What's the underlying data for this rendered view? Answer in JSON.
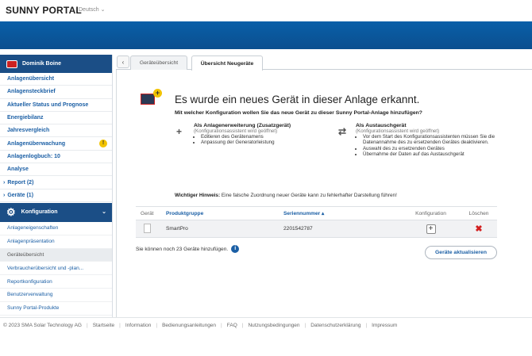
{
  "header": {
    "logo": "SUNNY PORTAL",
    "language": "Deutsch ⌄"
  },
  "sidebar": {
    "user": "Dominik Boine",
    "items": [
      {
        "label": "Anlagenübersicht"
      },
      {
        "label": "Anlagensteckbrief"
      },
      {
        "label": "Aktueller Status und Prognose"
      },
      {
        "label": "Energiebilanz"
      },
      {
        "label": "Jahresvergleich"
      },
      {
        "label": "Anlagenüberwachung",
        "warning": "!"
      },
      {
        "label": "Anlagenlogbuch: 10"
      },
      {
        "label": "Analyse"
      },
      {
        "label": "Report (2)",
        "chevron": "›"
      },
      {
        "label": "Geräte (1)",
        "chevron": "›"
      }
    ],
    "config_section": {
      "label": "Konfiguration",
      "chevron": "⌄"
    },
    "config_items": [
      {
        "label": "Anlageneigenschaften"
      },
      {
        "label": "Anlagenpräsentation"
      },
      {
        "label": "Geräteübersicht",
        "active": true
      },
      {
        "label": "Verbraucherübersicht und -plan..."
      },
      {
        "label": "Reportkonfiguration"
      },
      {
        "label": "Benutzerverwaltung"
      },
      {
        "label": "Sunny Portal-Produkte"
      }
    ]
  },
  "tabs": {
    "back": "‹",
    "tab1": "Geräteübersicht",
    "tab2": "Übersicht Neugeräte"
  },
  "main": {
    "heading": "Es wurde ein neues Gerät in dieser Anlage erkannt.",
    "question": "Mit welcher Konfiguration wollen Sie das neue Gerät zu dieser Sunny Portal-Anlage hinzufügen?",
    "option1": {
      "symbol": "+",
      "title": "Als Anlagenerweiterung (Zusatzgerät)",
      "subtitle": "(Konfigurationsassistent wird geöffnet)",
      "bullets": [
        "Editieren des Gerätenamens",
        "Anpassung der Generatorleistung"
      ]
    },
    "option2": {
      "symbol": "⇄",
      "title": "Als Austauschgerät",
      "subtitle": "(Konfigurationsassistent wird geöffnet)",
      "bullets": [
        "Vor dem Start des Konfigurationsassistenten müssen Sie die Datenannahme des zu ersetzenden Gerätes deaktivieren.",
        "Auswahl des zu ersetzenden Gerätes",
        "Übernahme der Daten auf das Austauschgerät"
      ]
    },
    "hint_label": "Wichtiger Hinweis:",
    "hint_text": " Eine falsche Zuordnung neuer Geräte kann zu fehlerhafter Darstellung führen!",
    "table": {
      "headers": {
        "device": "Gerät",
        "product_group": "Produktgruppe",
        "serial": "Seriennummer ▴",
        "config": "Konfiguration",
        "delete": "Löschen"
      },
      "rows": [
        {
          "product_group": "SmartPro",
          "serial": "2201542787",
          "config_symbol": "+",
          "delete_symbol": "✖"
        }
      ]
    },
    "remaining": "Sie können noch 23 Geräte hinzufügen.",
    "info_symbol": "i",
    "update_button": "Geräte aktualisieren"
  },
  "footer": {
    "copyright": "© 2023 SMA Solar Technology AG",
    "links": [
      "Startseite",
      "Information",
      "Bedienungsanleitungen",
      "FAQ",
      "Nutzungsbedingungen",
      "Datenschutzerklärung",
      "Impressum"
    ],
    "separator": "|"
  }
}
